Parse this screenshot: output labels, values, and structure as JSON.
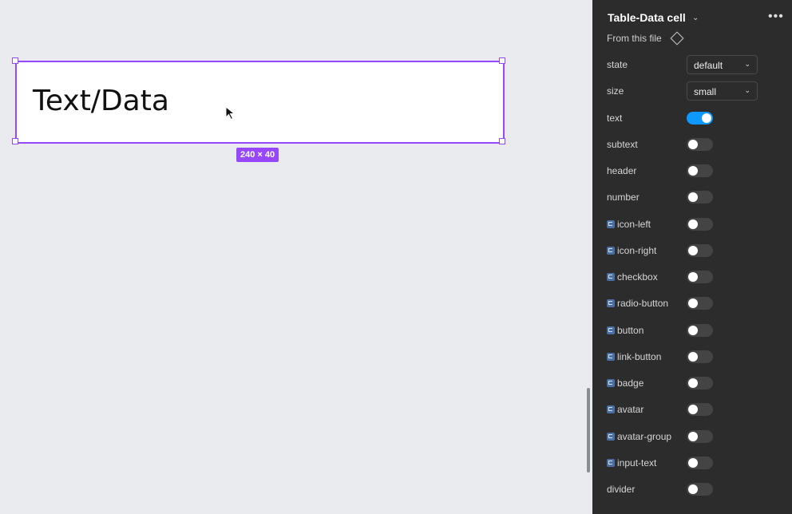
{
  "canvas": {
    "frame_text": "Text/Data",
    "size_badge": "240 × 40"
  },
  "panel": {
    "title": "Table-Data cell",
    "source": "From this file",
    "properties": [
      {
        "label": "state",
        "type": "dropdown",
        "value": "default"
      },
      {
        "label": "size",
        "type": "dropdown",
        "value": "small"
      },
      {
        "label": "text",
        "type": "toggle",
        "on": true,
        "component": false
      },
      {
        "label": "subtext",
        "type": "toggle",
        "on": false,
        "component": false
      },
      {
        "label": "header",
        "type": "toggle",
        "on": false,
        "component": false
      },
      {
        "label": "number",
        "type": "toggle",
        "on": false,
        "component": false
      },
      {
        "label": "icon-left",
        "type": "toggle",
        "on": false,
        "component": true
      },
      {
        "label": "icon-right",
        "type": "toggle",
        "on": false,
        "component": true
      },
      {
        "label": "checkbox",
        "type": "toggle",
        "on": false,
        "component": true
      },
      {
        "label": "radio-button",
        "type": "toggle",
        "on": false,
        "component": true
      },
      {
        "label": "button",
        "type": "toggle",
        "on": false,
        "component": true
      },
      {
        "label": "link-button",
        "type": "toggle",
        "on": false,
        "component": true
      },
      {
        "label": "badge",
        "type": "toggle",
        "on": false,
        "component": true
      },
      {
        "label": "avatar",
        "type": "toggle",
        "on": false,
        "component": true
      },
      {
        "label": "avatar-group",
        "type": "toggle",
        "on": false,
        "component": true
      },
      {
        "label": "input-text",
        "type": "toggle",
        "on": false,
        "component": true
      },
      {
        "label": "divider",
        "type": "toggle",
        "on": false,
        "component": false
      }
    ]
  },
  "colors": {
    "selection": "#9747ff",
    "toggle_on": "#0d99ff",
    "panel_bg": "#2c2c2c",
    "canvas_bg": "#e9ebef"
  }
}
